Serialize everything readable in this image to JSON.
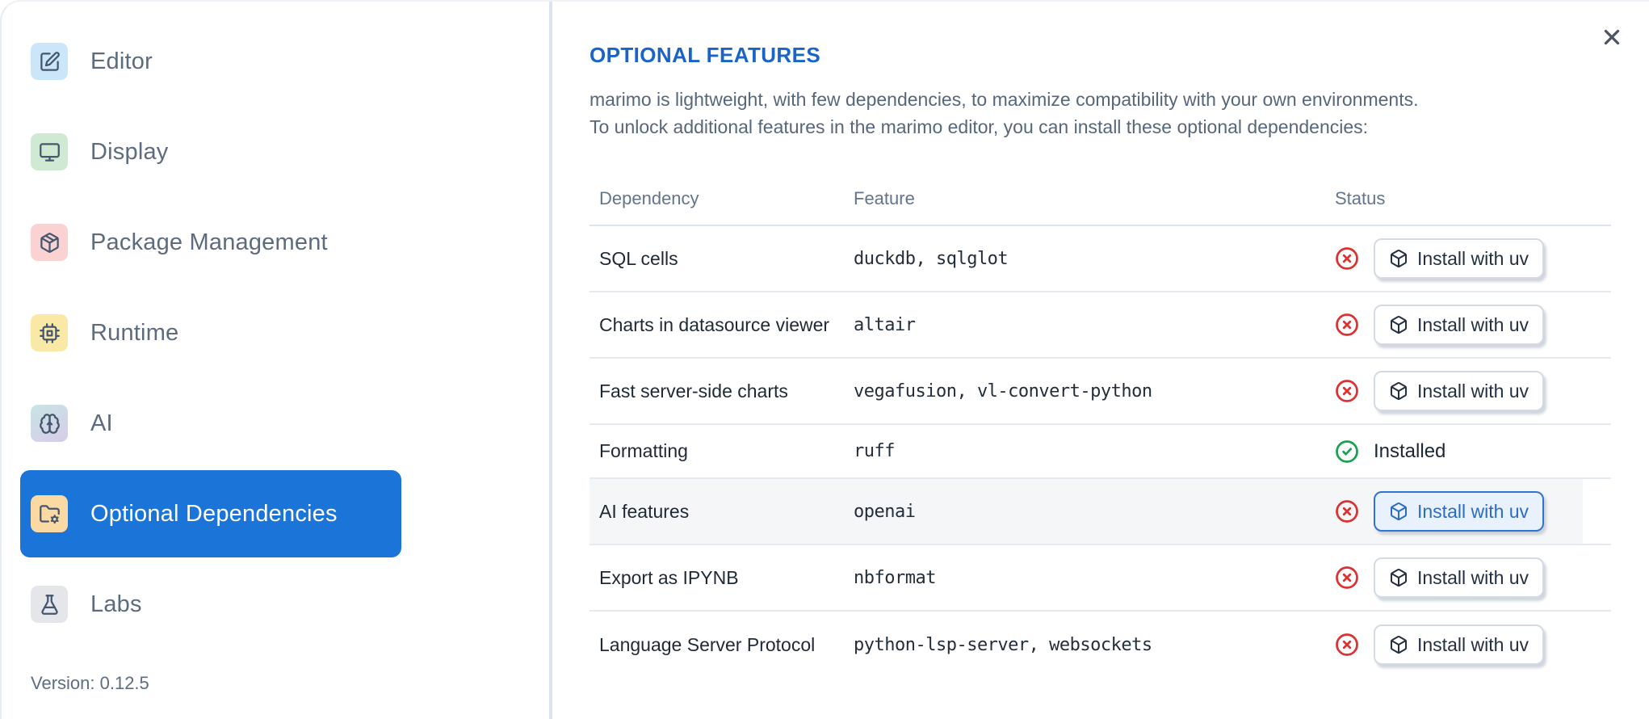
{
  "sidebar": {
    "items": [
      {
        "label": "Editor",
        "icon": "square-pen-icon",
        "icon_bg": "#cbe6f8",
        "selected": false
      },
      {
        "label": "Display",
        "icon": "monitor-icon",
        "icon_bg": "#cfe9d2",
        "selected": false
      },
      {
        "label": "Package Management",
        "icon": "package-icon",
        "icon_bg": "#fbd2d2",
        "selected": false
      },
      {
        "label": "Runtime",
        "icon": "cpu-icon",
        "icon_bg": "#fae9a6",
        "selected": false
      },
      {
        "label": "AI",
        "icon": "brain-icon",
        "icon_bg": "linear-gradient(150deg,#c6e6e4,#d8cbe9)",
        "selected": false
      },
      {
        "label": "Optional Dependencies",
        "icon": "folder-cog-icon",
        "icon_bg": "#fbd9a3",
        "selected": true
      },
      {
        "label": "Labs",
        "icon": "flask-icon",
        "icon_bg": "#e4e6ea",
        "selected": false
      }
    ],
    "version_label": "Version: 0.12.5"
  },
  "dialog": {
    "title": "OPTIONAL FEATURES",
    "description_lines": [
      "marimo is lightweight, with few dependencies, to maximize compatibility with your own environments.",
      "To unlock additional features in the marimo editor, you can install these optional dependencies:"
    ]
  },
  "table": {
    "columns": [
      "Dependency",
      "Feature",
      "Status"
    ],
    "rows": [
      {
        "dependency": "SQL cells",
        "feature": "duckdb, sqlglot",
        "installed": false,
        "action_label": "Install with uv",
        "highlighted": false,
        "focused": false
      },
      {
        "dependency": "Charts in datasource viewer",
        "feature": "altair",
        "installed": false,
        "action_label": "Install with uv",
        "highlighted": false,
        "focused": false
      },
      {
        "dependency": "Fast server-side charts",
        "feature": "vegafusion, vl-convert-python",
        "installed": false,
        "action_label": "Install with uv",
        "highlighted": false,
        "focused": false
      },
      {
        "dependency": "Formatting",
        "feature": "ruff",
        "installed": true,
        "status_label": "Installed",
        "highlighted": false,
        "focused": false
      },
      {
        "dependency": "AI features",
        "feature": "openai",
        "installed": false,
        "action_label": "Install with uv",
        "highlighted": true,
        "focused": true
      },
      {
        "dependency": "Export as IPYNB",
        "feature": "nbformat",
        "installed": false,
        "action_label": "Install with uv",
        "highlighted": false,
        "focused": false
      },
      {
        "dependency": "Language Server Protocol",
        "feature": "python-lsp-server, websockets",
        "installed": false,
        "action_label": "Install with uv",
        "highlighted": false,
        "focused": false
      }
    ]
  },
  "colors": {
    "accent_blue": "#1b74d8",
    "heading_blue": "#1a64c9",
    "error_red": "#dc3232",
    "success_green": "#1ba24e",
    "focused_button_border": "#2f74d0",
    "focused_button_bg": "#e9f1fc",
    "sidebar_divider": "#dbe3ee"
  }
}
